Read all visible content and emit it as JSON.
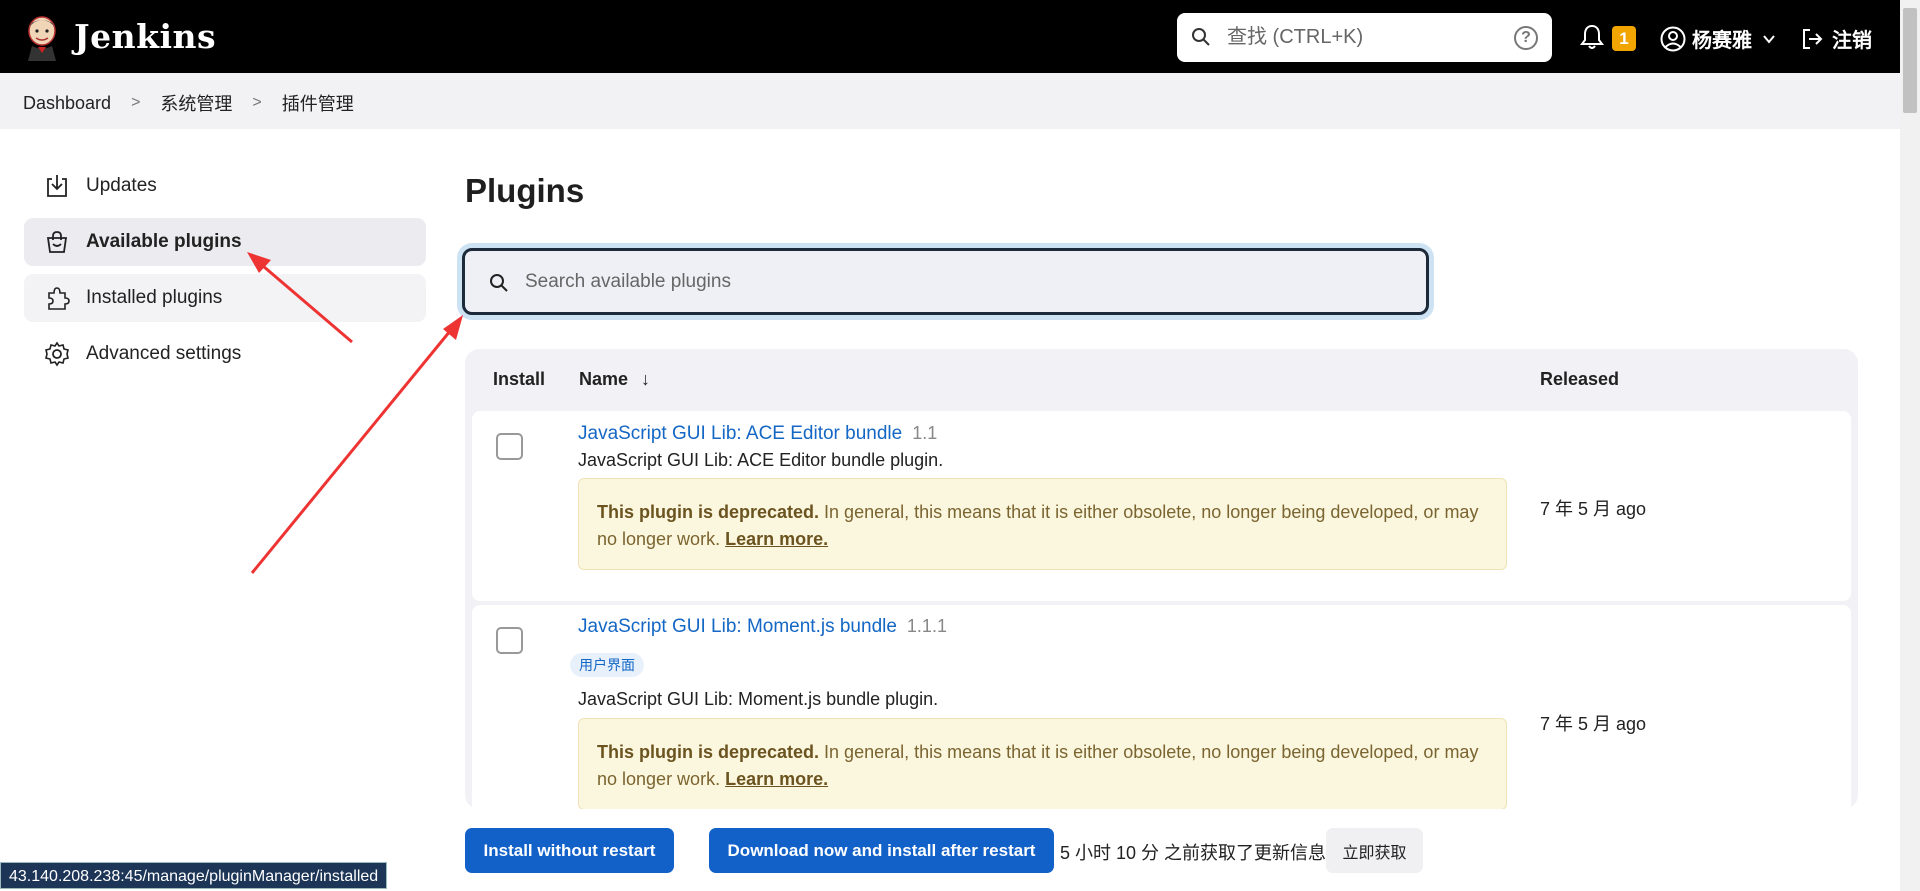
{
  "header": {
    "brand": "Jenkins",
    "search_placeholder": "查找 (CTRL+K)",
    "help_symbol": "?",
    "notification_count": "1",
    "user_name": "杨赛雅",
    "logout_label": "注销",
    "colors": {
      "bar": "#000000",
      "badge": "#f2a400"
    }
  },
  "breadcrumb": {
    "items": [
      "Dashboard",
      "系统管理",
      "插件管理"
    ],
    "separator": ">"
  },
  "sidebar": {
    "items": [
      {
        "label": "Updates",
        "icon": "download-icon",
        "state": "normal"
      },
      {
        "label": "Available plugins",
        "icon": "shopping-bag-icon",
        "state": "active"
      },
      {
        "label": "Installed plugins",
        "icon": "puzzle-icon",
        "state": "hover"
      },
      {
        "label": "Advanced settings",
        "icon": "gear-icon",
        "state": "normal"
      }
    ]
  },
  "main": {
    "title": "Plugins",
    "search_placeholder": "Search available plugins",
    "table": {
      "columns": {
        "install": "Install",
        "name": "Name",
        "sort_indicator": "↓",
        "released": "Released"
      },
      "rows": [
        {
          "name": "JavaScript GUI Lib: ACE Editor bundle",
          "version": "1.1",
          "tag": "",
          "description": "JavaScript GUI Lib: ACE Editor bundle plugin.",
          "warning_bold": "This plugin is deprecated.",
          "warning_text": " In general, this means that it is either obsolete, no longer being developed, or may no longer work. ",
          "warning_link": "Learn more.",
          "released": "7 年 5 月 ago"
        },
        {
          "name": "JavaScript GUI Lib: Moment.js bundle",
          "version": "1.1.1",
          "tag": "用户界面",
          "description": "JavaScript GUI Lib: Moment.js bundle plugin.",
          "warning_bold": "This plugin is deprecated.",
          "warning_text": " In general, this means that it is either obsolete, no longer being developed, or may no longer work. ",
          "warning_link": "Learn more.",
          "released": "7 年 5 月 ago"
        }
      ]
    }
  },
  "bottom": {
    "install_without_restart": "Install without restart",
    "download_and_install": "Download now and install after restart",
    "fetched_info": "5 小时 10 分 之前获取了更新信息",
    "fetch_now": "立即获取",
    "status_url": "43.140.208.238:45/manage/pluginManager/installed"
  },
  "accent_colors": {
    "link": "#1467c4",
    "primary_button": "#1161c9",
    "annotation_arrow": "#ee3333"
  }
}
